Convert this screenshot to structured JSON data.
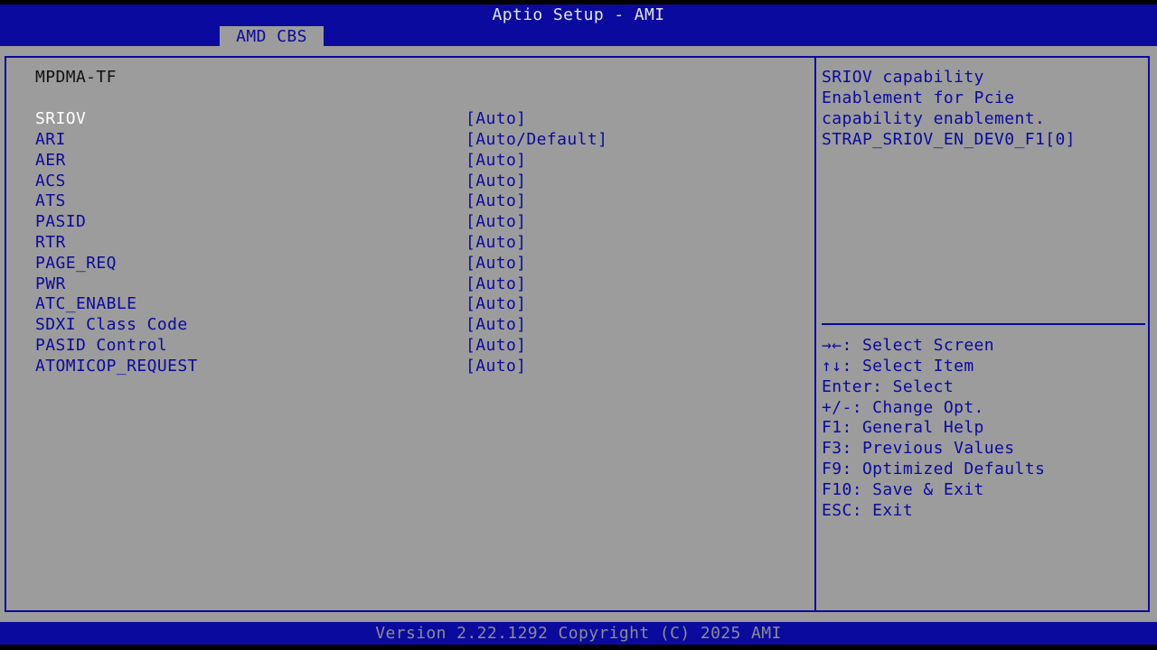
{
  "header": {
    "title": "Aptio Setup - AMI",
    "tab_label": "AMD CBS"
  },
  "main": {
    "section_title": "MPDMA-TF",
    "settings": [
      {
        "label": "SRIOV",
        "value": "[Auto]"
      },
      {
        "label": "ARI",
        "value": "[Auto/Default]"
      },
      {
        "label": "AER",
        "value": "[Auto]"
      },
      {
        "label": "ACS",
        "value": "[Auto]"
      },
      {
        "label": "ATS",
        "value": "[Auto]"
      },
      {
        "label": "PASID",
        "value": "[Auto]"
      },
      {
        "label": "RTR",
        "value": "[Auto]"
      },
      {
        "label": "PAGE_REQ",
        "value": "[Auto]"
      },
      {
        "label": "PWR",
        "value": "[Auto]"
      },
      {
        "label": "ATC_ENABLE",
        "value": "[Auto]"
      },
      {
        "label": "SDXI Class Code",
        "value": "[Auto]"
      },
      {
        "label": "PASID Control",
        "value": "[Auto]"
      },
      {
        "label": "ATOMICOP_REQUEST",
        "value": "[Auto]"
      }
    ]
  },
  "help": {
    "lines": [
      "SRIOV capability",
      "Enablement for Pcie",
      "capability enablement.",
      "STRAP_SRIOV_EN_DEV0_F1[0]"
    ]
  },
  "keys": [
    "→←: Select Screen",
    "↑↓: Select Item",
    "Enter: Select",
    "+/-: Change Opt.",
    "F1: General Help",
    "F3: Previous Values",
    "F9: Optimized Defaults",
    "F10: Save & Exit",
    "ESC: Exit"
  ],
  "footer": {
    "version": "Version 2.22.1292 Copyright (C) 2025 AMI"
  },
  "colors": {
    "bios_blue": "#0a0a9e",
    "panel_gray": "#9c9c9c",
    "selected_text": "#ffffff"
  }
}
